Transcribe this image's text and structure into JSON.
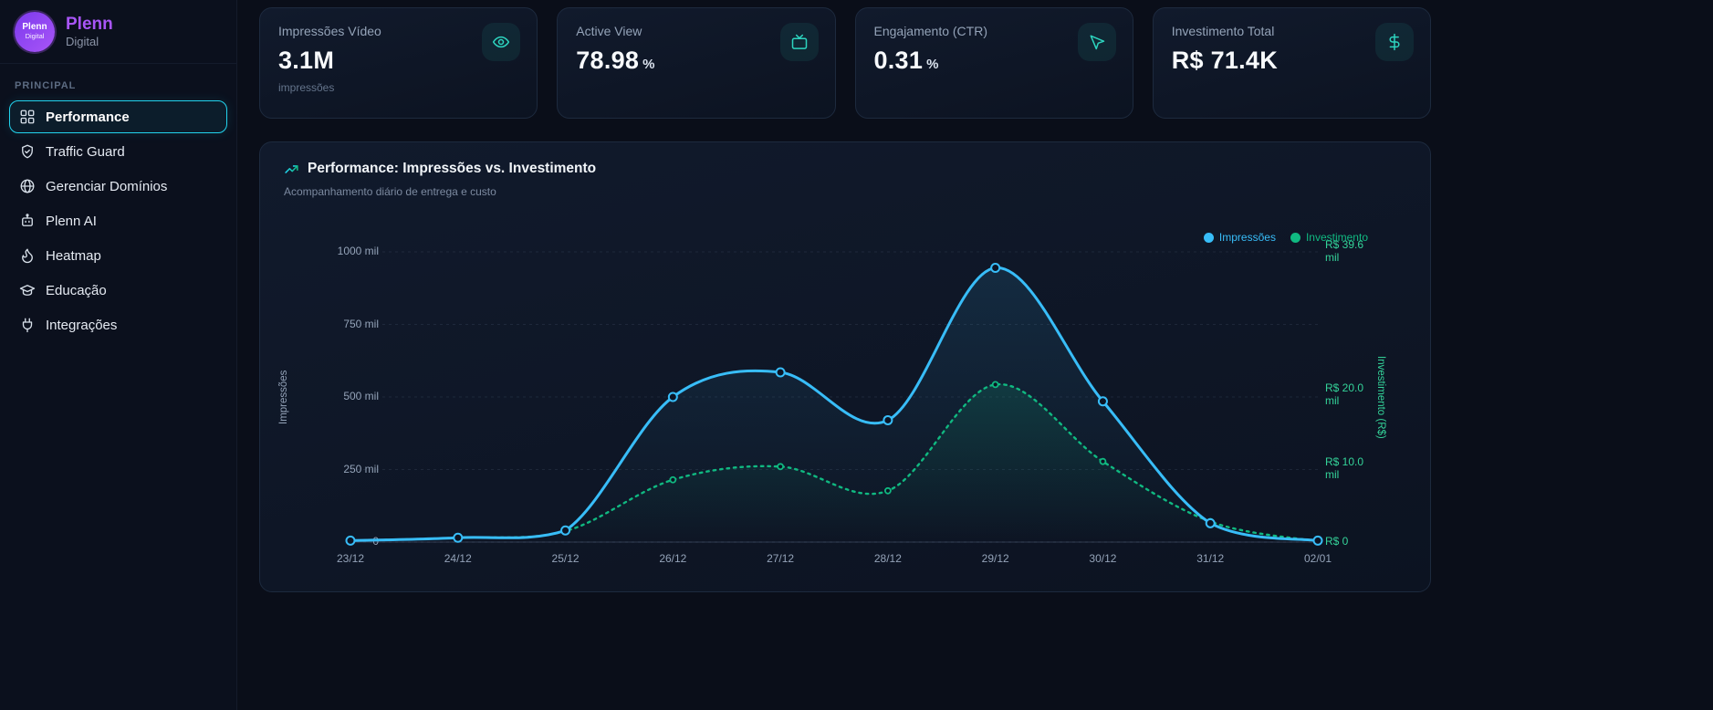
{
  "brand": {
    "name": "Plenn",
    "subtitle": "Digital",
    "logo_line1": "Plenn",
    "logo_line2": "Digital"
  },
  "sidebar": {
    "section_label": "PRINCIPAL",
    "items": [
      {
        "label": "Performance",
        "icon": "dashboard-grid-icon",
        "active": true
      },
      {
        "label": "Traffic Guard",
        "icon": "shield-check-icon",
        "active": false
      },
      {
        "label": "Gerenciar Domínios",
        "icon": "globe-icon",
        "active": false
      },
      {
        "label": "Plenn AI",
        "icon": "bot-icon",
        "active": false
      },
      {
        "label": "Heatmap",
        "icon": "flame-icon",
        "active": false
      },
      {
        "label": "Educação",
        "icon": "graduation-cap-icon",
        "active": false
      },
      {
        "label": "Integrações",
        "icon": "plug-icon",
        "active": false
      }
    ]
  },
  "kpis": [
    {
      "label": "Impressões Vídeo",
      "value": "3.1M",
      "unit": "",
      "sublabel": "impressões",
      "icon": "eye-icon"
    },
    {
      "label": "Active View",
      "value": "78.98",
      "unit": "%",
      "sublabel": "",
      "icon": "tv-icon"
    },
    {
      "label": "Engajamento (CTR)",
      "value": "0.31",
      "unit": "%",
      "sublabel": "",
      "icon": "cursor-icon"
    },
    {
      "label": "Investimento Total",
      "value": "R$ 71.4K",
      "unit": "",
      "sublabel": "",
      "icon": "dollar-icon"
    }
  ],
  "chart": {
    "title": "Performance: Impressões vs. Investimento",
    "subtitle": "Acompanhamento diário de entrega e custo"
  },
  "chart_data": {
    "type": "line",
    "title": "Performance: Impressões vs. Investimento",
    "categories": [
      "23/12",
      "24/12",
      "25/12",
      "26/12",
      "27/12",
      "28/12",
      "29/12",
      "30/12",
      "31/12",
      "02/01"
    ],
    "series": [
      {
        "name": "Impressões",
        "axis": "left",
        "style": "solid",
        "color": "#38bdf8",
        "unit": "mil",
        "values": [
          5,
          15,
          40,
          500,
          585,
          420,
          945,
          485,
          65,
          5
        ]
      },
      {
        "name": "Investimento",
        "axis": "right",
        "style": "dashed",
        "color": "#10b981",
        "unit": "R$ mil",
        "values": [
          0.2,
          0.6,
          1.5,
          8.5,
          10.3,
          7.0,
          21.5,
          11.0,
          2.8,
          0.1
        ]
      }
    ],
    "yaxis_left": {
      "title": "Impressões",
      "max": 1000,
      "min": 0,
      "ticks": [
        "1000 mil",
        "750 mil",
        "500 mil",
        "250 mil",
        "0"
      ],
      "tick_values": [
        1000,
        750,
        500,
        250,
        0
      ]
    },
    "yaxis_right": {
      "title": "Investimento (R$)",
      "max": 39.6,
      "min": 0,
      "ticks": [
        "R$ 39.6 mil",
        "R$ 20.0 mil",
        "R$ 10.0 mil",
        "R$ 0"
      ],
      "tick_values": [
        39.6,
        20,
        10,
        0
      ]
    },
    "legend": [
      "Impressões",
      "Investimento"
    ],
    "legend_position": "top-right",
    "grid": true
  },
  "colors": {
    "accent_cyan": "#22d3ee",
    "series_blue": "#38bdf8",
    "series_green": "#10b981",
    "brand_purple": "#a855f7",
    "kpi_icon_teal": "#2dd4bf"
  }
}
